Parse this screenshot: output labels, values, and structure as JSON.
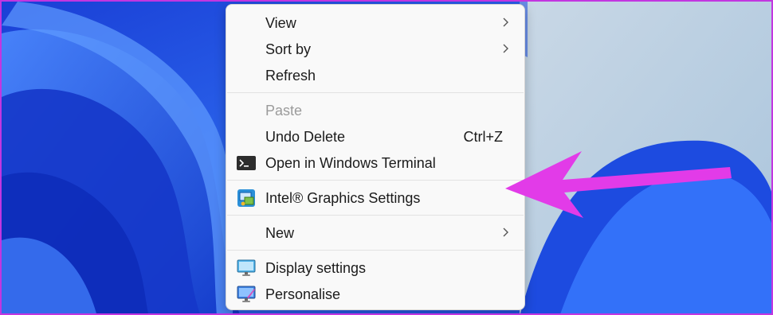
{
  "context_menu": {
    "items": [
      {
        "label": "View",
        "submenu": true
      },
      {
        "label": "Sort by",
        "submenu": true
      },
      {
        "label": "Refresh"
      },
      {
        "label": "Paste",
        "disabled": true
      },
      {
        "label": "Undo Delete",
        "shortcut": "Ctrl+Z"
      },
      {
        "label": "Open in Windows Terminal",
        "icon": "terminal-icon"
      },
      {
        "label": "Intel® Graphics Settings",
        "icon": "intel-graphics-icon"
      },
      {
        "label": "New",
        "submenu": true
      },
      {
        "label": "Display settings",
        "icon": "display-settings-icon"
      },
      {
        "label": "Personalise",
        "icon": "personalise-icon"
      }
    ]
  },
  "annotation": {
    "icon": "pointer-arrow",
    "color": "#e23be8"
  },
  "colors": {
    "frame_border": "#c236e0",
    "menu_background": "#f9f9f9",
    "wallpaper_blue": "#1c4fe0"
  }
}
